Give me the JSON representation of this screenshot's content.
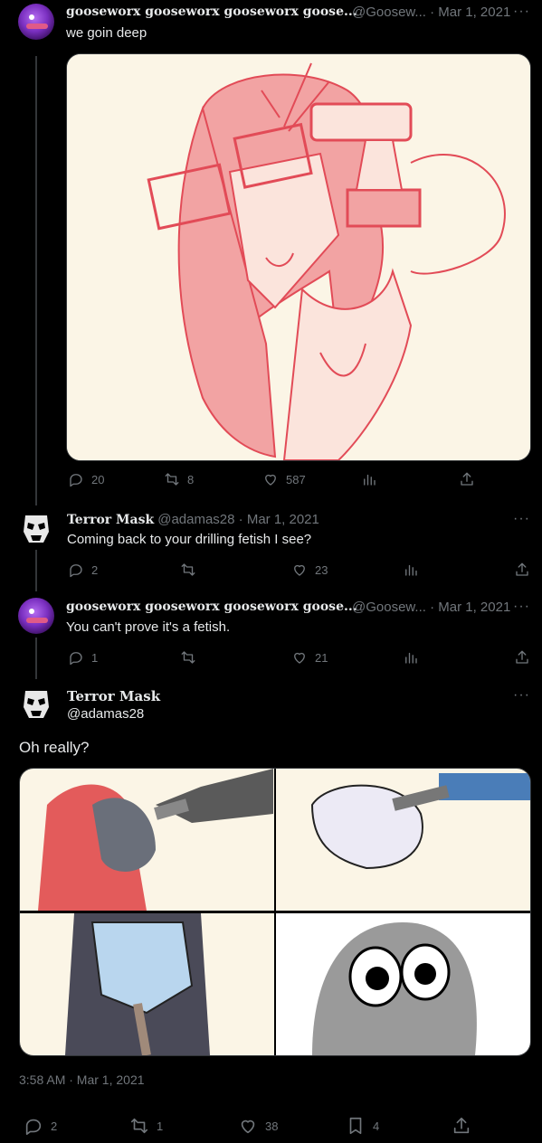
{
  "tweet1": {
    "name": "gooseworx gooseworx gooseworx goose...",
    "handle_date": "@Goosew... · Mar 1, 2021",
    "text": "we goin deep",
    "replies": "20",
    "retweets": "8",
    "likes": "587"
  },
  "tweet2": {
    "name": "Terror Mask",
    "handle_date": "@adamas28 · Mar 1, 2021",
    "text": "Coming back to your drilling fetish I see?",
    "replies": "2",
    "likes": "23"
  },
  "tweet3": {
    "name": "gooseworx gooseworx gooseworx goose...",
    "handle_date": "@Goosew... · Mar 1, 2021",
    "text": "You can't prove it's a fetish.",
    "replies": "1",
    "likes": "21"
  },
  "main": {
    "name": "Terror Mask",
    "handle": "@adamas28",
    "text": "Oh really?",
    "timestamp": "3:58 AM · Mar 1, 2021",
    "replies": "2",
    "retweets": "1",
    "likes": "38",
    "bookmarks": "4"
  },
  "more_label": "···",
  "colors": {
    "background": "#000000",
    "text": "#e7e9ea",
    "muted": "#71767b",
    "divider": "#333639"
  },
  "icons": [
    "reply-icon",
    "retweet-icon",
    "like-icon",
    "views-icon",
    "share-icon",
    "bookmark-icon",
    "more-icon"
  ]
}
